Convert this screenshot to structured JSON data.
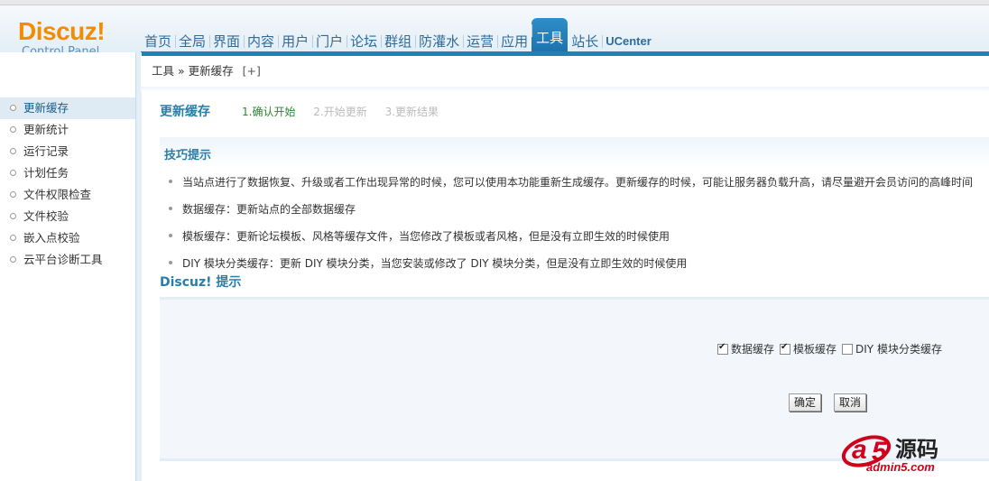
{
  "logo": {
    "brand": "Discuz!",
    "sub": "Control Panel"
  },
  "nav": {
    "items": [
      {
        "label": "首页"
      },
      {
        "label": "全局"
      },
      {
        "label": "界面"
      },
      {
        "label": "内容"
      },
      {
        "label": "用户"
      },
      {
        "label": "门户"
      },
      {
        "label": "论坛"
      },
      {
        "label": "群组"
      },
      {
        "label": "防灌水"
      },
      {
        "label": "运营"
      },
      {
        "label": "应用"
      },
      {
        "label": "工具"
      },
      {
        "label": "站长"
      },
      {
        "label": "UCenter"
      }
    ],
    "active": "工具"
  },
  "breadcrumb": {
    "root": "工具",
    "sep": "»",
    "current": "更新缓存",
    "add": "[+]"
  },
  "sidebar": {
    "items": [
      {
        "label": "更新缓存"
      },
      {
        "label": "更新统计"
      },
      {
        "label": "运行记录"
      },
      {
        "label": "计划任务"
      },
      {
        "label": "文件权限检查"
      },
      {
        "label": "文件校验"
      },
      {
        "label": "嵌入点校验"
      },
      {
        "label": "云平台诊断工具"
      }
    ],
    "active": "更新缓存"
  },
  "main": {
    "title": "更新缓存",
    "steps": [
      "1.确认开始",
      "2.开始更新",
      "3.更新结果"
    ],
    "tips_title": "技巧提示",
    "tips": [
      "当站点进行了数据恢复、升级或者工作出现异常的时候，您可以使用本功能重新生成缓存。更新缓存的时候，可能让服务器负载升高，请尽量避开会员访问的高峰时间",
      "数据缓存：更新站点的全部数据缓存",
      "模板缓存：更新论坛模板、风格等缓存文件，当您修改了模板或者风格，但是没有立即生效的时候使用",
      "DIY 模块分类缓存：更新 DIY 模块分类，当您安装或修改了 DIY 模块分类，但是没有立即生效的时候使用"
    ],
    "notice_title": "Discuz! 提示",
    "options": [
      {
        "label": "数据缓存",
        "checked": true
      },
      {
        "label": "模板缓存",
        "checked": true
      },
      {
        "label": "DIY 模块分类缓存",
        "checked": false
      }
    ],
    "confirm": "确定",
    "cancel": "取消"
  },
  "watermark": {
    "text": "a5源码",
    "url": "admin5.com"
  },
  "colors": {
    "accent": "#1f81ba",
    "logo": "#f28c00",
    "title": "#2a7da8",
    "step_current": "#2c8a2c"
  }
}
